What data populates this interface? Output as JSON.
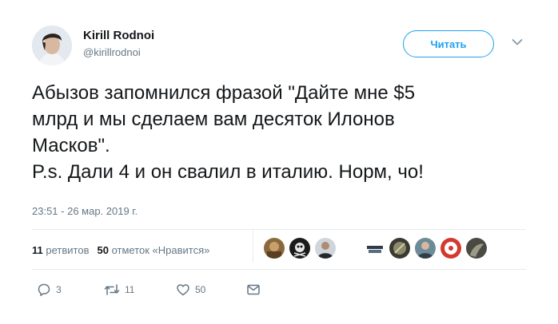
{
  "author": {
    "name": "Kirill Rodnoi",
    "handle": "@kirillrodnoi"
  },
  "follow_button": {
    "label": "Читать"
  },
  "tweet": {
    "lines": [
      "Абызов запомнился фразой \"Дайте мне $5",
      "млрд и мы сделаем вам десяток Илонов",
      "Масков\".",
      "P.s. Дали 4 и он свалил в италию. Норм, чо!"
    ],
    "timestamp": "23:51 - 26 мар. 2019 г."
  },
  "stats": {
    "retweets_count": "11",
    "retweets_label": "ретвитов",
    "likes_count": "50",
    "likes_label": "отметок «Нравится»"
  },
  "actions": {
    "replies": "3",
    "retweets": "11",
    "likes": "50"
  },
  "colors": {
    "accent": "#1da1f2",
    "secondary_text": "#657786",
    "divider": "#e6ecf0"
  }
}
